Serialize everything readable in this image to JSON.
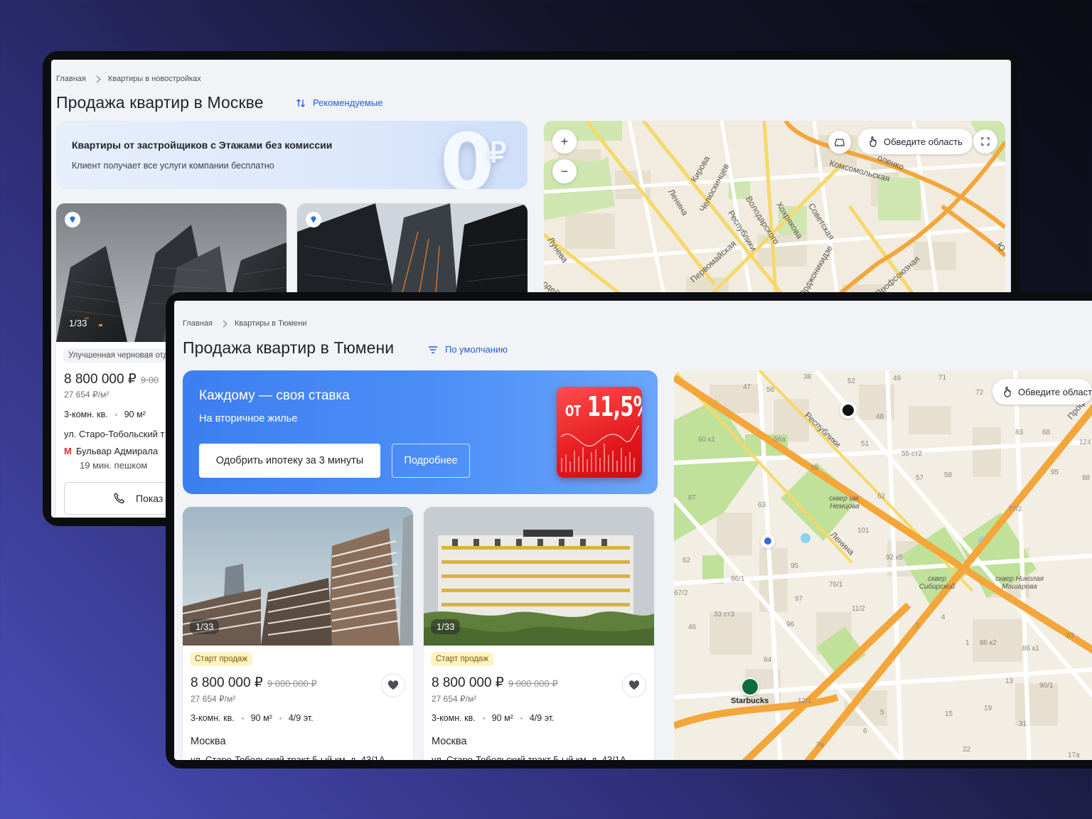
{
  "screen_moscow": {
    "breadcrumb": [
      "Главная",
      "Квартиры в новостройках"
    ],
    "title": "Продажа квартир в Москве",
    "sort_label": "Рекомендуемые",
    "banner": {
      "title": "Квартиры от застройщиков с Этажами без комиссии",
      "subtitle": "Клиент получает все услуги компании бесплатно",
      "big_glyph": "0",
      "currency_glyph": "₽"
    },
    "card": {
      "counter": "1/33",
      "tag": "Улучшенная черновая отд",
      "price": "8 800 000 ₽",
      "old_price": "9 00",
      "price_per_m2": "27 654 ₽/м²",
      "rooms": "3-комн. кв.",
      "area": "90 м²",
      "address": "ул. Старо-Тобольский т",
      "metro_letter": "М",
      "metro": "Бульвар Адмирала",
      "walk": "19 мин. пешком",
      "call_button": "Показ"
    },
    "map": {
      "zoom_in": "+",
      "zoom_out": "−",
      "draw_area": "Обведите область",
      "streets": [
        "Кирова",
        "Ленина",
        "Челюскинцев",
        "Володарского",
        "Республики",
        "Хохрякова",
        "Советская",
        "Комсомольская",
        "Первомайская",
        "Лунева",
        "Орджоникидзе",
        "Профсоюзная",
        "оленко",
        "одейск",
        "Ю"
      ]
    }
  },
  "screen_tyumen": {
    "breadcrumb": [
      "Главная",
      "Квартиры в Тюмени"
    ],
    "title": "Продажа квартир в Тюмени",
    "sort_label": "По умолчанию",
    "banner": {
      "title": "Каждому — своя ставка",
      "subtitle": "На вторичное жилье",
      "primary_button": "Одобрить ипотеку за 3 минуты",
      "secondary_button": "Подробнее",
      "rate_prefix": "ОТ",
      "rate": "11,5%"
    },
    "cards": [
      {
        "counter": "1/33",
        "tag": "Старт продаж",
        "price": "8 800 000 ₽",
        "old_price": "9 000 000 ₽",
        "price_per_m2": "27 654 ₽/м²",
        "rooms": "3-комн. кв.",
        "area": "90 м²",
        "floor": "4/9 эт.",
        "city": "Москва",
        "address": "ул. Старо-Тобольский тракт 5-ый км, д. 43/1А"
      },
      {
        "counter": "1/33",
        "tag": "Старт продаж",
        "price": "8 800 000 ₽",
        "old_price": "9 000 000 ₽",
        "price_per_m2": "27 654 ₽/м²",
        "rooms": "3-комн. кв.",
        "area": "90 м²",
        "floor": "4/9 эт.",
        "city": "Москва",
        "address": "ул. Старо-Тобольский тракт 5-ый км, д. 43/1А"
      }
    ],
    "map": {
      "draw_area": "Обведите област",
      "streets": [
        "Республики",
        "Ленина",
        "Проф"
      ],
      "parks": [
        "сквер им. Немцова",
        "сквер Сибирский",
        "сквер Николая Машарова"
      ],
      "poi": "Starbucks",
      "house_numbers": [
        "56",
        "47",
        "52",
        "49",
        "71",
        "72",
        "38",
        "60 к1",
        "56а",
        "48",
        "51",
        "59",
        "55 ст2",
        "83",
        "68",
        "124",
        "87",
        "63",
        "62",
        "57",
        "58",
        "88",
        "95",
        "77/2",
        "101",
        "92 к5",
        "62",
        "86/1",
        "95",
        "76/1",
        "67/2",
        "97",
        "11/2",
        "33 ст3",
        "96",
        "46",
        "2",
        "4",
        "86 к2",
        "86 к1",
        "83",
        "94",
        "12/1",
        "13",
        "90/1",
        "19",
        "31",
        "5",
        "6",
        "15",
        "22",
        "7а",
        "17а",
        "1"
      ]
    }
  },
  "colors": {
    "accent_blue": "#1d5fd1",
    "banner_blue": "#3d7ef0",
    "rate_red": "#e0151b",
    "road_orange": "#f4a63a",
    "road_yellow": "#f6d86a",
    "park_green": "#b6dd8f"
  }
}
